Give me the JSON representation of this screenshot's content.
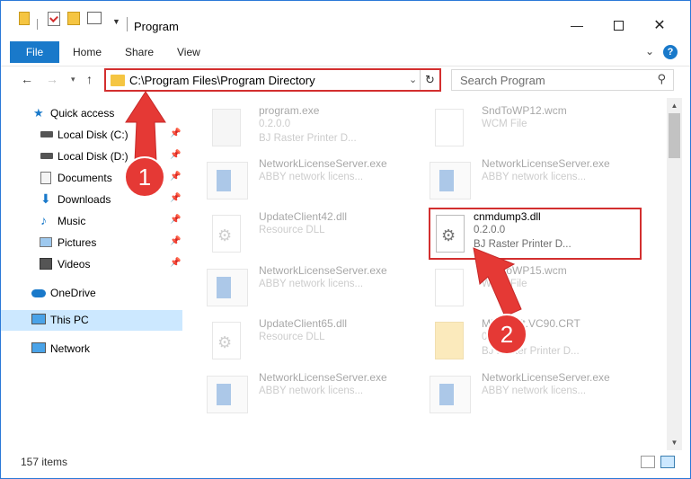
{
  "window": {
    "title": "Program",
    "accent": "#1979ca",
    "annotation_color": "#d32f2f"
  },
  "ribbon": {
    "tabs": [
      "File",
      "Home",
      "Share",
      "View"
    ],
    "help": "?"
  },
  "nav": {
    "back_icon": "arrow-left-icon",
    "forward_icon": "arrow-right-icon",
    "up_icon": "arrow-up-icon",
    "address_path": "C:\\Program Files\\Program Directory",
    "search_placeholder": "Search Program"
  },
  "sidebar": {
    "items": [
      {
        "label": "Quick access",
        "icon": "star-icon",
        "pinned": false
      },
      {
        "label": "Local Disk (C:)",
        "icon": "drive-icon",
        "pinned": true
      },
      {
        "label": "Local Disk (D:)",
        "icon": "drive-icon",
        "pinned": true
      },
      {
        "label": "Documents",
        "icon": "documents-icon",
        "pinned": true
      },
      {
        "label": "Downloads",
        "icon": "download-icon",
        "pinned": true
      },
      {
        "label": "Music",
        "icon": "music-icon",
        "pinned": true
      },
      {
        "label": "Pictures",
        "icon": "pictures-icon",
        "pinned": true
      },
      {
        "label": "Videos",
        "icon": "videos-icon",
        "pinned": true
      },
      {
        "label": "OneDrive",
        "icon": "cloud-icon",
        "pinned": false
      },
      {
        "label": "This PC",
        "icon": "computer-icon",
        "pinned": false,
        "selected": true
      },
      {
        "label": "Network",
        "icon": "network-icon",
        "pinned": false
      }
    ]
  },
  "files": [
    {
      "name": "program.exe",
      "line1": "0.2.0.0",
      "line2": "BJ Raster Printer D...",
      "icon": "program-icon"
    },
    {
      "name": "SndToWP12.wcm",
      "line1": "WCM File",
      "line2": "",
      "icon": "document-icon"
    },
    {
      "name": "NetworkLicenseServer.exe",
      "line1": "ABBY network licens...",
      "line2": "",
      "icon": "app-icon"
    },
    {
      "name": "NetworkLicenseServer.exe",
      "line1": "ABBY network licens...",
      "line2": "",
      "icon": "app-icon"
    },
    {
      "name": "UpdateClient42.dll",
      "line1": "Resource DLL",
      "line2": "",
      "icon": "dll-icon"
    },
    {
      "name": "cnmdump3.dll",
      "line1": "0.2.0.0",
      "line2": "BJ Raster Printer D...",
      "icon": "dll-icon",
      "highlighted": true
    },
    {
      "name": "NetworkLicenseServer.exe",
      "line1": "ABBY network licens...",
      "line2": "",
      "icon": "app-icon"
    },
    {
      "name": "SndToWP15.wcm",
      "line1": "WCM File",
      "line2": "",
      "icon": "document-icon"
    },
    {
      "name": "UpdateClient65.dll",
      "line1": "Resource DLL",
      "line2": "",
      "icon": "dll-icon"
    },
    {
      "name": "Microsoft.VC90.CRT",
      "line1": "0.2.0.0",
      "line2": "BJ Raster Printer D...",
      "icon": "folder-icon"
    },
    {
      "name": "NetworkLicenseServer.exe",
      "line1": "ABBY network licens...",
      "line2": "",
      "icon": "app-icon"
    },
    {
      "name": "NetworkLicenseServer.exe",
      "line1": "ABBY network licens...",
      "line2": "",
      "icon": "app-icon"
    }
  ],
  "status": {
    "item_count": "157 items"
  },
  "annotations": {
    "step1": "1",
    "step2": "2"
  }
}
